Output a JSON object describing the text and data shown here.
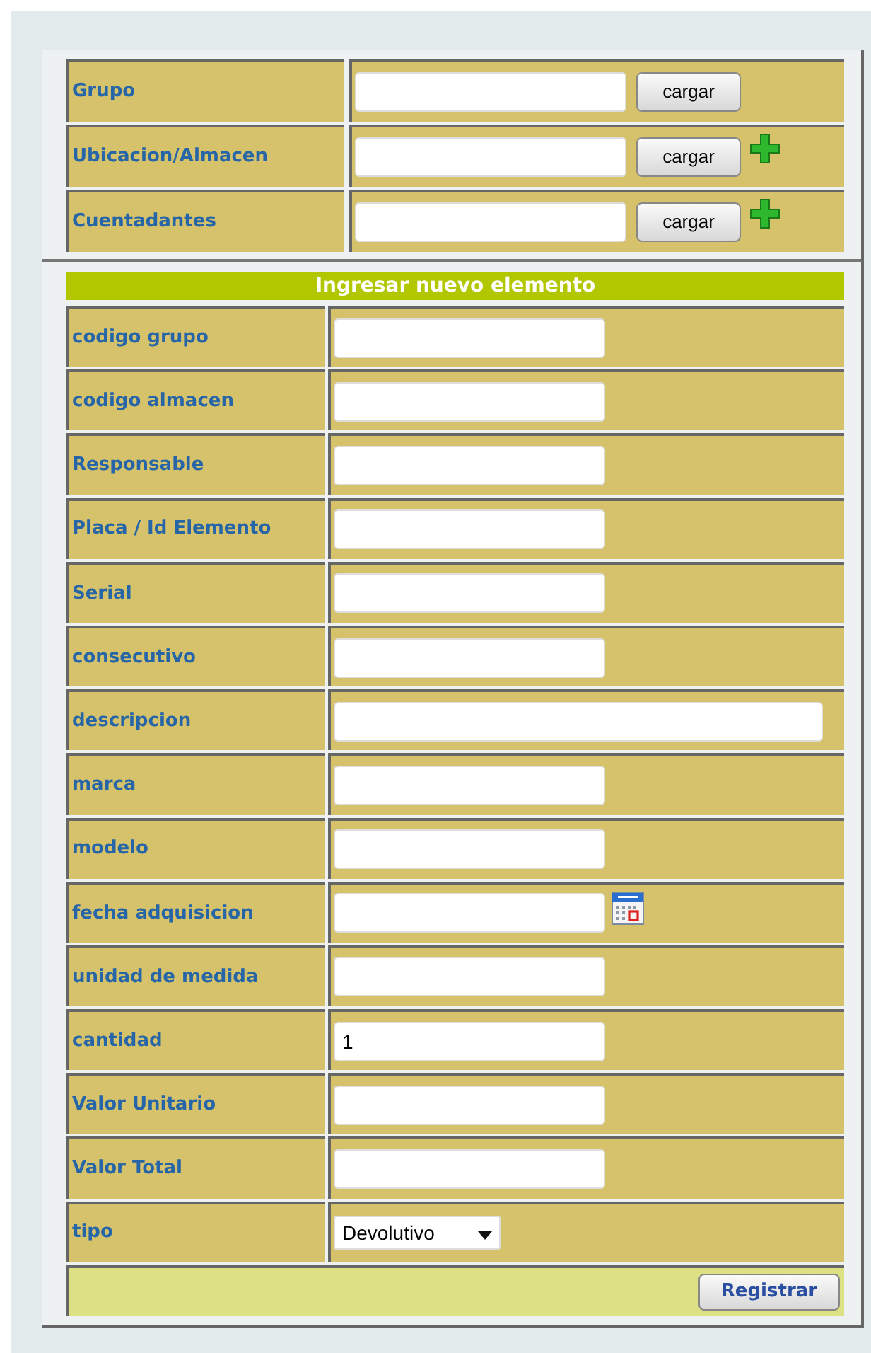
{
  "lookups": [
    {
      "label": "Grupo",
      "button": "cargar",
      "add": false
    },
    {
      "label": "Ubicacion/Almacen",
      "button": "cargar",
      "add": true
    },
    {
      "label": "Cuentadantes",
      "button": "cargar",
      "add": true
    }
  ],
  "form": {
    "title": "Ingresar nuevo elemento",
    "fields": [
      {
        "label": "codigo grupo",
        "kind": "text"
      },
      {
        "label": "codigo almacen",
        "kind": "text"
      },
      {
        "label": "Responsable",
        "kind": "text"
      },
      {
        "label": "Placa / Id Elemento",
        "kind": "text"
      },
      {
        "label": "Serial",
        "kind": "text"
      },
      {
        "label": "consecutivo",
        "kind": "text"
      },
      {
        "label": "descripcion",
        "kind": "wide"
      },
      {
        "label": "marca",
        "kind": "text"
      },
      {
        "label": "modelo",
        "kind": "text"
      },
      {
        "label": "fecha adquisicion",
        "kind": "date"
      },
      {
        "label": "unidad de medida",
        "kind": "text"
      },
      {
        "label": "cantidad",
        "kind": "text",
        "value": "1"
      },
      {
        "label": "Valor Unitario",
        "kind": "text"
      },
      {
        "label": "Valor Total",
        "kind": "text"
      },
      {
        "label": "tipo",
        "kind": "select",
        "value": "Devolutivo"
      }
    ],
    "submit": "Registrar"
  }
}
